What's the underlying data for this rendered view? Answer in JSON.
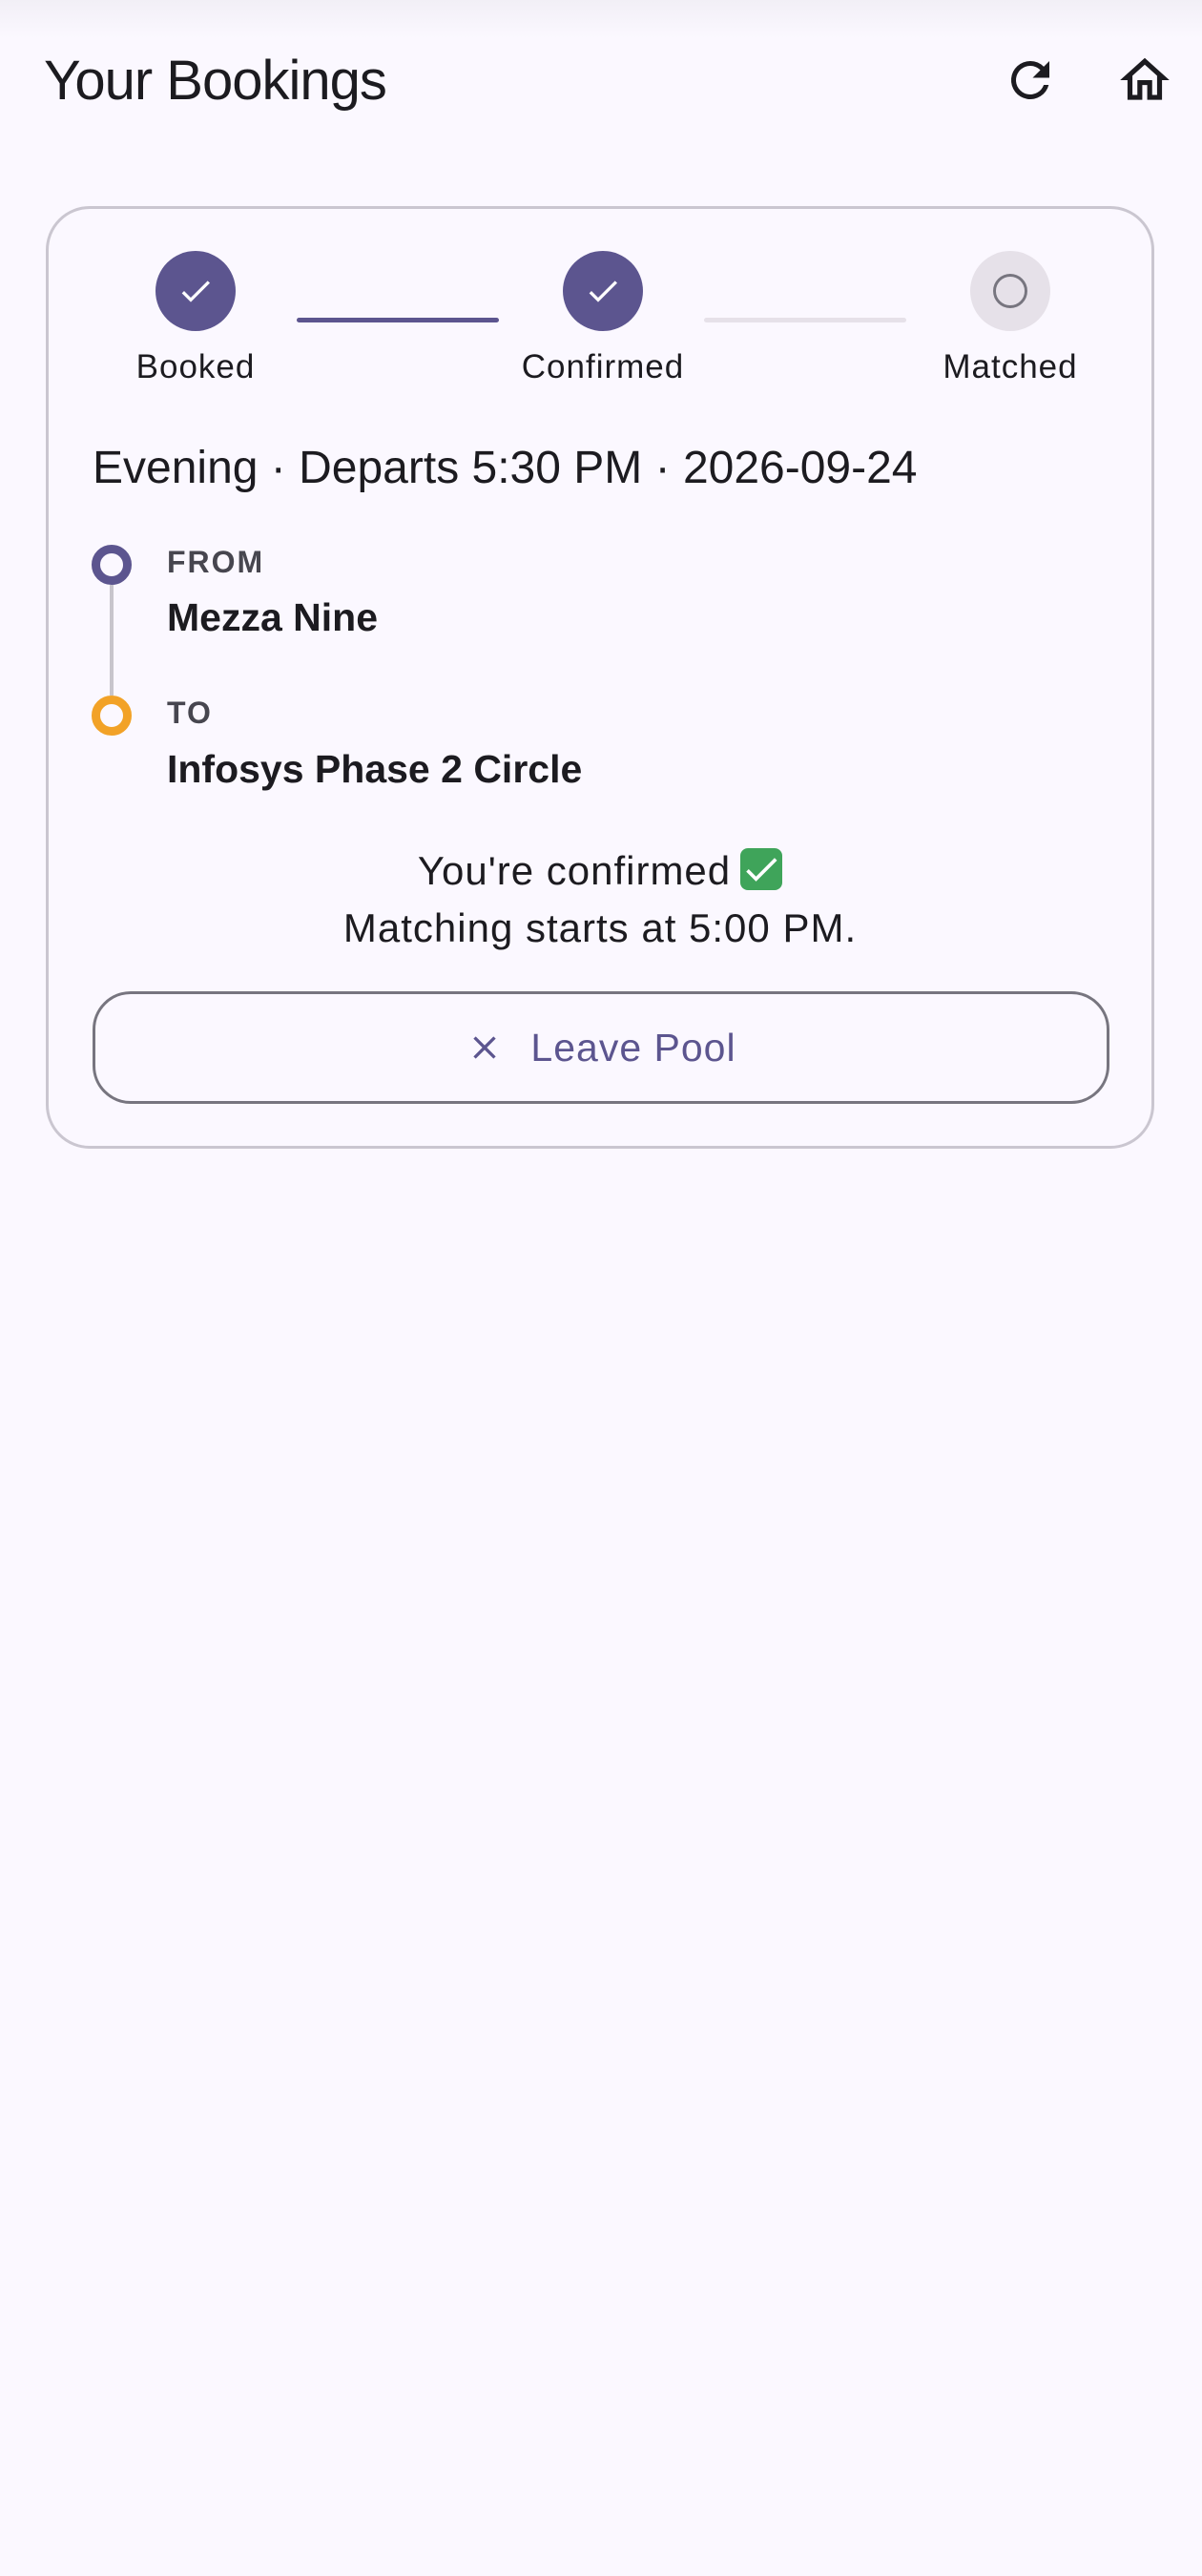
{
  "appbar": {
    "title": "Your Bookings",
    "refresh_icon": "refresh-icon",
    "home_icon": "home-icon"
  },
  "booking": {
    "stepper": {
      "steps": [
        {
          "label": "Booked",
          "state": "done"
        },
        {
          "label": "Confirmed",
          "state": "done"
        },
        {
          "label": "Matched",
          "state": "pending"
        }
      ],
      "connectors": [
        {
          "state": "done"
        },
        {
          "state": "pending"
        }
      ]
    },
    "summary": "Evening · Departs 5:30 PM · 2026-09-24",
    "route": {
      "from_caption": "FROM",
      "from_place": "Mezza Nine",
      "to_caption": "TO",
      "to_place": "Infosys Phase 2 Circle"
    },
    "status": {
      "line1": "You're confirmed",
      "line1_emoji": "✅",
      "line2": "Matching starts at 5:00 PM."
    },
    "leave_button": {
      "label": "Leave Pool",
      "icon": "close-icon"
    }
  },
  "colors": {
    "background": "#fbf8ff",
    "primary": "#5c558f",
    "accent_orange": "#f2a227",
    "pending": "#e6e1e9",
    "outline": "#cac6d0"
  }
}
